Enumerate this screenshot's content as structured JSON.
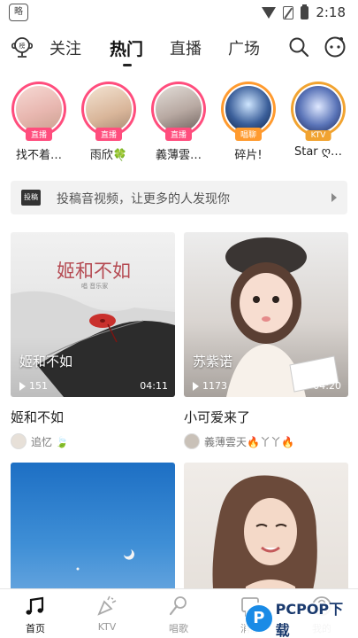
{
  "status_bar": {
    "app_icon_text": "略",
    "time": "2:18"
  },
  "header": {
    "tabs": [
      {
        "label": "关注"
      },
      {
        "label": "热门"
      },
      {
        "label": "直播"
      },
      {
        "label": "广场"
      }
    ],
    "active_tab": "热门"
  },
  "avatars": [
    {
      "name": "找不着…",
      "badge": "直播"
    },
    {
      "name": "雨欣🍀",
      "badge": "直播"
    },
    {
      "name": "義薄雲…",
      "badge": "直播"
    },
    {
      "name": "碎片!",
      "badge": "唱聊"
    },
    {
      "name": "Star ღ…",
      "badge": "KTV"
    }
  ],
  "post_bar": {
    "tag": "投稿",
    "text": "投稿音视频，让更多的人发现你"
  },
  "cards": [
    {
      "overlay_title": "姬和不如",
      "plays": "151",
      "duration": "04:11",
      "title": "姬和不如",
      "user": "追忆 🍃",
      "art_title": "姬和不如",
      "art_sub": "唱 音乐家"
    },
    {
      "overlay_title": "苏紫诺",
      "plays": "1173",
      "duration": "04:20",
      "title": "小可爱来了",
      "user": "義薄雲天🔥丫丫🔥"
    },
    {
      "overlay_title": "",
      "plays": "",
      "duration": "",
      "title": "",
      "user": ""
    },
    {
      "overlay_title": "",
      "plays": "",
      "duration": "",
      "title": "",
      "user": ""
    }
  ],
  "bottom_nav": [
    {
      "label": "首页",
      "icon": "music-note-icon"
    },
    {
      "label": "KTV",
      "icon": "party-popper-icon"
    },
    {
      "label": "唱歌",
      "icon": "microphone-icon"
    },
    {
      "label": "消息",
      "icon": "message-icon"
    },
    {
      "label": "我的",
      "icon": "user-icon"
    }
  ],
  "watermark": {
    "logo": "P",
    "text": "PCPOP下载"
  }
}
